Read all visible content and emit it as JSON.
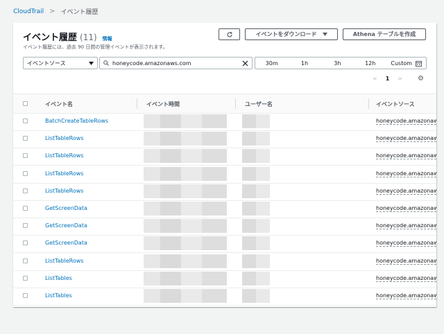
{
  "breadcrumb": {
    "root": "CloudTrail",
    "separator": ">",
    "current": "イベント履歴"
  },
  "header": {
    "title": "イベント履歴",
    "count": "(11)",
    "info": "情報",
    "description": "イベント履歴には、過去 90 日間の管理イベントが表示されます。"
  },
  "actions": {
    "refresh_icon": "refresh-icon",
    "download_label": "イベントをダウンロード",
    "athena_label": "Athena テーブルを作成"
  },
  "filter": {
    "attribute": "イベントソース",
    "value": "honeycode.amazonaws.com"
  },
  "time_range": {
    "options": [
      "30m",
      "1h",
      "3h",
      "12h"
    ],
    "custom": "Custom"
  },
  "pagination": {
    "prev": "<",
    "page": "1",
    "next": ">"
  },
  "table": {
    "headers": {
      "event_name": "イベント名",
      "event_time": "イベント時間",
      "user_name": "ユーザー名",
      "event_source": "イベントソース"
    },
    "rows": [
      {
        "event_name": "BatchCreateTableRows",
        "event_source": "honeycode.amazonaws.com"
      },
      {
        "event_name": "ListTableRows",
        "event_source": "honeycode.amazonaws.com"
      },
      {
        "event_name": "ListTableRows",
        "event_source": "honeycode.amazonaws.com"
      },
      {
        "event_name": "ListTableRows",
        "event_source": "honeycode.amazonaws.com"
      },
      {
        "event_name": "ListTableRows",
        "event_source": "honeycode.amazonaws.com"
      },
      {
        "event_name": "GetScreenData",
        "event_source": "honeycode.amazonaws.com"
      },
      {
        "event_name": "GetScreenData",
        "event_source": "honeycode.amazonaws.com"
      },
      {
        "event_name": "GetScreenData",
        "event_source": "honeycode.amazonaws.com"
      },
      {
        "event_name": "ListTableRows",
        "event_source": "honeycode.amazonaws.com"
      },
      {
        "event_name": "ListTables",
        "event_source": "honeycode.amazonaws.com"
      },
      {
        "event_name": "ListTables",
        "event_source": "honeycode.amazonaws.com"
      }
    ]
  },
  "colors": {
    "link": "#0073bb",
    "background": "#f2f3f3"
  }
}
